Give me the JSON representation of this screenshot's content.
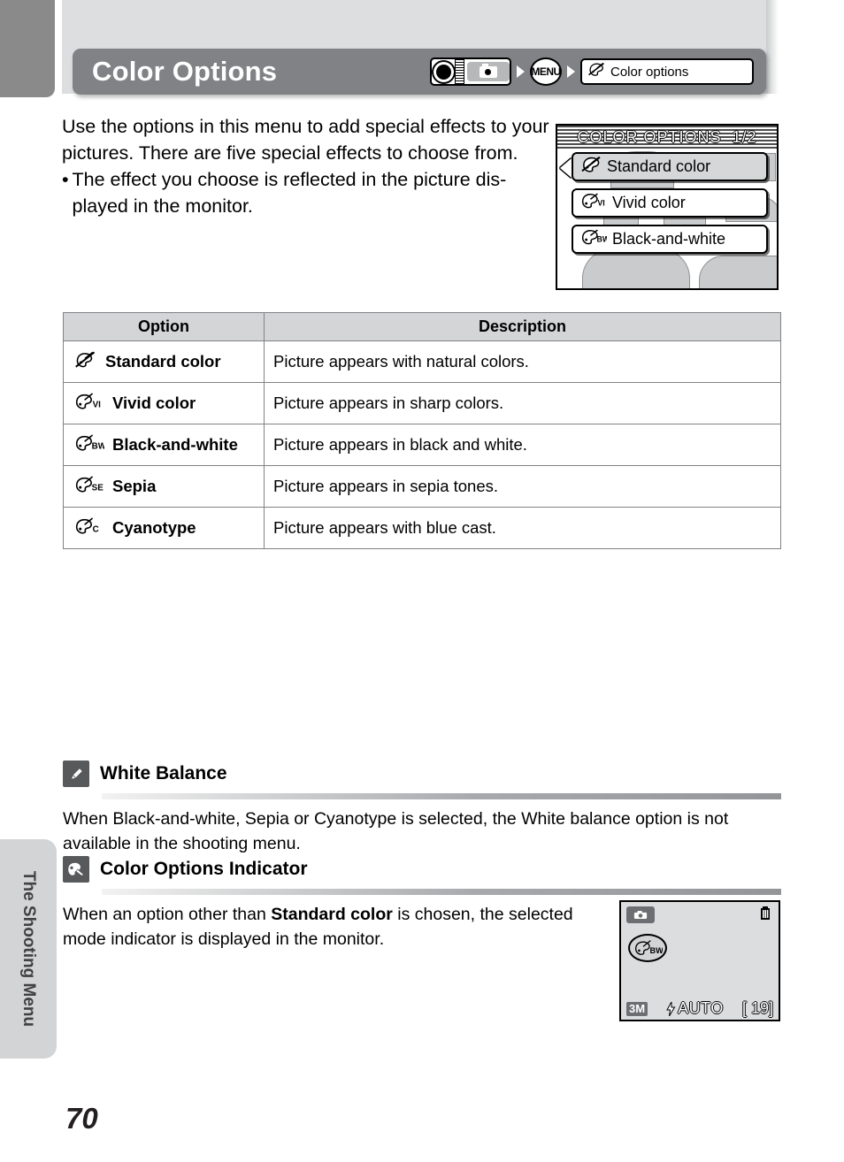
{
  "header": {
    "title": "Color Options",
    "nav": {
      "mode_dial_icon": "camera-mode-dial-icon",
      "arrow_icon": "arrow-right-icon",
      "menu_button_label": "MENU",
      "menu_item_icon": "palette-standard-color-icon",
      "menu_item_label": "Color options"
    }
  },
  "intro": {
    "paragraph": "Use the options in this menu to add special effects to your pictures. There are five special effects to choose from.",
    "bullet_dot": "•",
    "bullet": "The effect you choose is reflected in the picture dis-played in the monitor."
  },
  "lcd_menu": {
    "title": "COLOR OPTIONS",
    "page_indicator": "1/2",
    "cursor_icon": "left-arrow-cursor-icon",
    "items": [
      {
        "icon": "palette-standard-color-icon",
        "label": "Standard color",
        "selected": true
      },
      {
        "icon": "palette-vivid-icon",
        "label": "Vivid color",
        "selected": false
      },
      {
        "icon": "palette-bw-icon",
        "label": "Black-and-white",
        "selected": false
      }
    ]
  },
  "table": {
    "headers": {
      "option": "Option",
      "description": "Description"
    },
    "rows": [
      {
        "icon": "palette-standard-color-icon",
        "suffix": "",
        "option": "Standard color",
        "description": "Picture appears with natural colors."
      },
      {
        "icon": "palette-vivid-icon",
        "suffix": "VI",
        "option": "Vivid color",
        "description": "Picture appears in sharp colors."
      },
      {
        "icon": "palette-bw-icon",
        "suffix": "BW",
        "option": "Black-and-white",
        "description": "Picture appears in black and white."
      },
      {
        "icon": "palette-sepia-icon",
        "suffix": "SE",
        "option": "Sepia",
        "description": "Picture appears in sepia tones."
      },
      {
        "icon": "palette-cyanotype-icon",
        "suffix": "C",
        "option": "Cyanotype",
        "description": "Picture appears with blue cast."
      }
    ]
  },
  "notes": [
    {
      "icon": "pencil-note-icon",
      "title": "White Balance",
      "body": "When Black-and-white, Sepia or Cyanotype is selected, the White balance option is not available in the shooting menu."
    },
    {
      "icon": "palette-note-icon",
      "title": "Color Options Indicator",
      "body_before": "When an option other than ",
      "body_bold": "Standard color",
      "body_after": " is chosen, the selected mode indicator is displayed in the monitor."
    }
  ],
  "monitor": {
    "mode_icon": "camera-mode-icon",
    "battery_icon": "battery-icon",
    "color_indicator_icon": "palette-bw-indicator-icon",
    "image_size": "3M",
    "flash_icon": "flash-icon",
    "flash_mode": "AUTO",
    "frames_remaining": "[  19]"
  },
  "sidebar": {
    "tab_label": "The Shooting Menu"
  },
  "page": {
    "number": "70"
  },
  "colors": {
    "title_bar": "#808285",
    "header_band": "#dcdee0",
    "corner_tab": "#8a8a8a",
    "table_header": "#d4d5d7",
    "sidebar_tab": "#d3d4d6",
    "note_icon": "#58595b"
  }
}
